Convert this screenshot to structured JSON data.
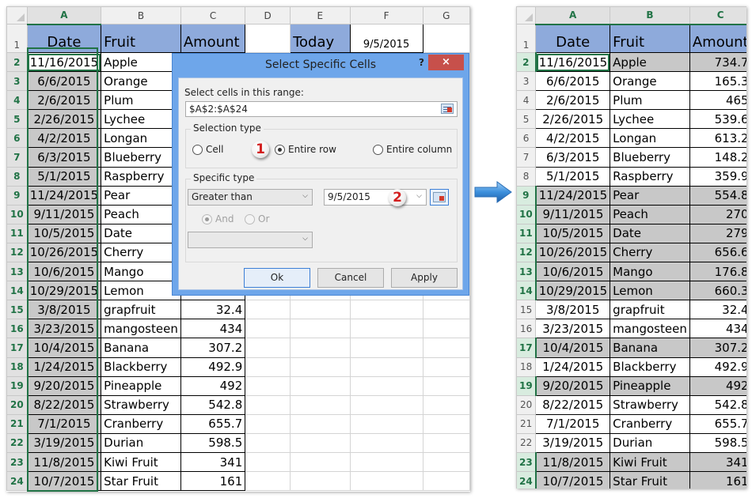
{
  "columns_left": [
    "A",
    "B",
    "C",
    "D",
    "E",
    "F",
    "G"
  ],
  "columns_right": [
    "A",
    "B",
    "C"
  ],
  "headers": {
    "date": "Date",
    "fruit": "Fruit",
    "amount": "Amount"
  },
  "today": {
    "label": "Today",
    "value": "9/5/2015"
  },
  "rows": [
    {
      "n": "2",
      "date": "11/16/2015",
      "fruit": "Apple",
      "amount": "734.7",
      "match": true
    },
    {
      "n": "3",
      "date": "6/6/2015",
      "fruit": "Orange",
      "amount": "165.3",
      "match": false
    },
    {
      "n": "4",
      "date": "2/6/2015",
      "fruit": "Plum",
      "amount": "465",
      "match": false
    },
    {
      "n": "5",
      "date": "2/26/2015",
      "fruit": "Lychee",
      "amount": "539.6",
      "match": false
    },
    {
      "n": "6",
      "date": "4/2/2015",
      "fruit": "Longan",
      "amount": "613.2",
      "match": false
    },
    {
      "n": "7",
      "date": "6/3/2015",
      "fruit": "Blueberry",
      "amount": "148.2",
      "match": false
    },
    {
      "n": "8",
      "date": "5/1/2015",
      "fruit": "Raspberry",
      "amount": "359.9",
      "match": false
    },
    {
      "n": "9",
      "date": "11/24/2015",
      "fruit": "Pear",
      "amount": "554.8",
      "match": true
    },
    {
      "n": "10",
      "date": "9/11/2015",
      "fruit": "Peach",
      "amount": "270",
      "match": true
    },
    {
      "n": "11",
      "date": "10/5/2015",
      "fruit": "Date",
      "amount": "279",
      "match": true
    },
    {
      "n": "12",
      "date": "10/26/2015",
      "fruit": "Cherry",
      "amount": "656.6",
      "match": true
    },
    {
      "n": "13",
      "date": "10/6/2015",
      "fruit": "Mango",
      "amount": "176.8",
      "match": true
    },
    {
      "n": "14",
      "date": "10/29/2015",
      "fruit": "Lemon",
      "amount": "660.3",
      "match": true
    },
    {
      "n": "15",
      "date": "3/8/2015",
      "fruit": "grapfruit",
      "amount": "32.4",
      "match": false
    },
    {
      "n": "16",
      "date": "3/23/2015",
      "fruit": "mangosteen",
      "amount": "434",
      "match": false
    },
    {
      "n": "17",
      "date": "10/4/2015",
      "fruit": "Banana",
      "amount": "307.2",
      "match": true
    },
    {
      "n": "18",
      "date": "1/24/2015",
      "fruit": "Blackberry",
      "amount": "492.9",
      "match": false
    },
    {
      "n": "19",
      "date": "9/20/2015",
      "fruit": "Pineapple",
      "amount": "492",
      "match": true
    },
    {
      "n": "20",
      "date": "8/22/2015",
      "fruit": "Strawberry",
      "amount": "542.8",
      "match": false
    },
    {
      "n": "21",
      "date": "7/1/2015",
      "fruit": "Cranberry",
      "amount": "655.7",
      "match": false
    },
    {
      "n": "22",
      "date": "3/19/2015",
      "fruit": "Durian",
      "amount": "598.5",
      "match": false
    },
    {
      "n": "23",
      "date": "11/8/2015",
      "fruit": "Kiwi Fruit",
      "amount": "341",
      "match": true
    },
    {
      "n": "24",
      "date": "10/7/2015",
      "fruit": "Star Fruit",
      "amount": "161",
      "match": true
    }
  ],
  "dialog": {
    "title": "Select Specific Cells",
    "help": "?",
    "close": "×",
    "range_label": "Select cells in this range:",
    "range_value": "$A$2:$A$24",
    "selection_type_label": "Selection type",
    "options": {
      "cell": "Cell",
      "entire_row": "Entire row",
      "entire_column": "Entire column"
    },
    "selected_option": "Entire row",
    "specific_type_label": "Specific type",
    "condition1": "Greater than",
    "value1": "9/5/2015",
    "and_label": "And",
    "or_label": "Or",
    "condition2": "",
    "buttons": {
      "ok": "Ok",
      "cancel": "Cancel",
      "apply": "Apply"
    },
    "step1": "1",
    "step2": "2"
  },
  "colors": {
    "header_fill": "#8eaadb",
    "selection_green": "#217346",
    "highlight_gray": "#c8c8c8",
    "dialog_frame": "#6ea6ea",
    "close_red": "#c7504b"
  }
}
